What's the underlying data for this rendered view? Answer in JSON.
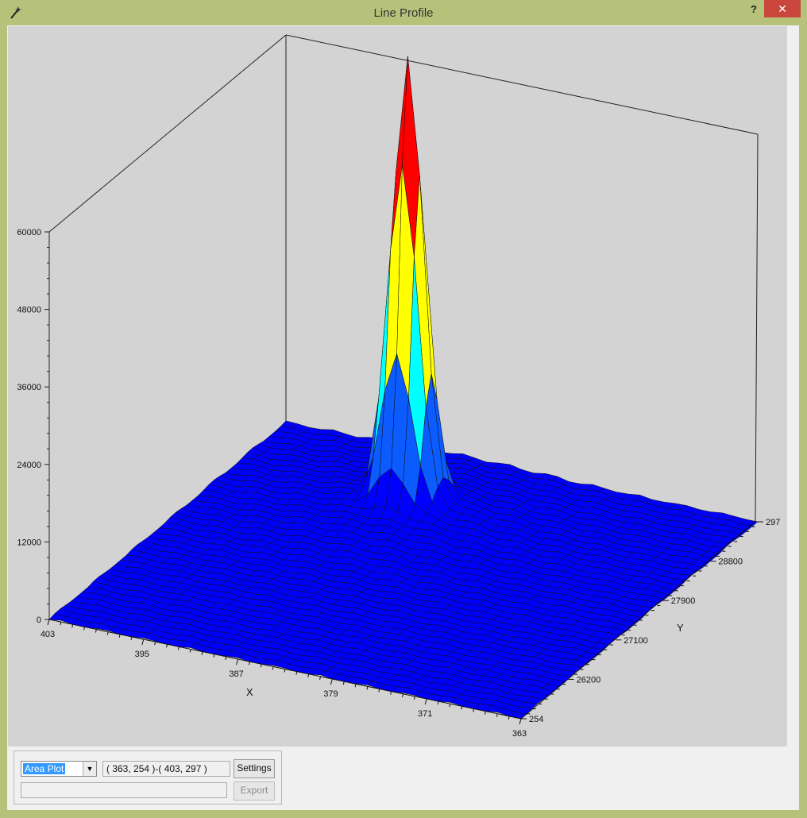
{
  "window": {
    "title": "Line Profile",
    "help_label": "?",
    "close_label": "✕",
    "app_icon": "wand-icon"
  },
  "controls": {
    "plot_type": "Area Plot",
    "plot_type_options": [
      "Area Plot"
    ],
    "region": "( 363, 254 )-( 403, 297 )",
    "settings_label": "Settings",
    "export_label": "Export",
    "status_text": ""
  },
  "chart_data": {
    "type": "surface",
    "title": "",
    "z_ticks": [
      "0",
      "12000",
      "24000",
      "36000",
      "48000",
      "60000"
    ],
    "x_label": "X",
    "x_ticks": [
      "403",
      "395",
      "387",
      "379",
      "371",
      "363"
    ],
    "y_label": "Y",
    "y_ticks": [
      "254",
      "26200",
      "27100",
      "27900",
      "28800",
      "297"
    ],
    "x_range": [
      403,
      363
    ],
    "y_range": [
      254,
      297
    ],
    "z_range": [
      0,
      60000
    ],
    "peak_value": 68000,
    "colors": [
      "#0000ff",
      "#0b5bff",
      "#00ffff",
      "#ffff00",
      "#ff0000"
    ]
  }
}
